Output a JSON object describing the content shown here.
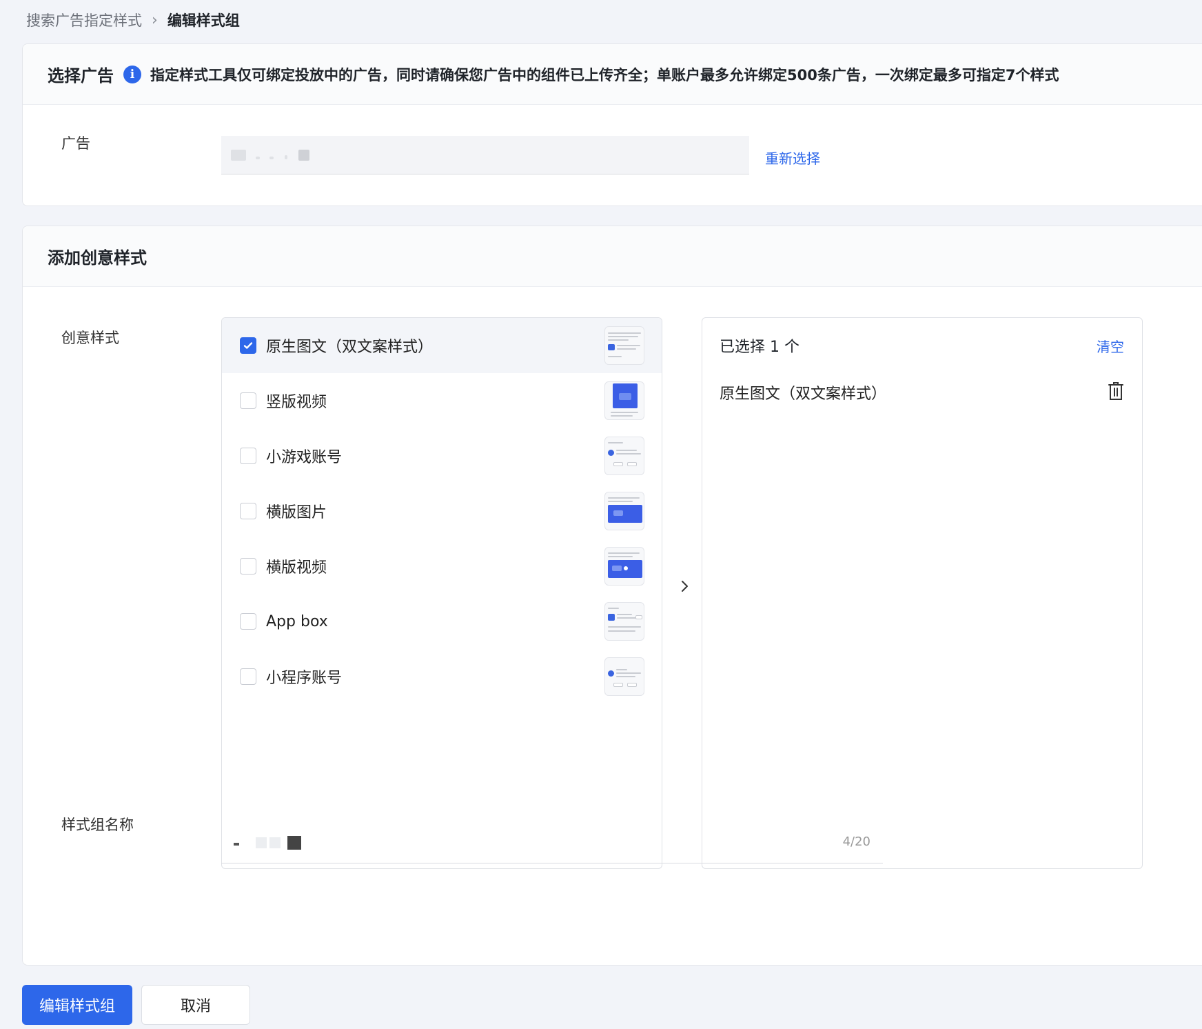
{
  "breadcrumb": {
    "parent": "搜索广告指定样式",
    "current": "编辑样式组"
  },
  "select_ad": {
    "title": "选择广告",
    "notice": "指定样式工具仅可绑定投放中的广告，同时请确保您广告中的组件已上传齐全；单账户最多允许绑定500条广告，一次绑定最多可指定7个样式",
    "ad_label": "广告",
    "reselect_label": "重新选择"
  },
  "creative": {
    "title": "添加创意样式",
    "style_label": "创意样式",
    "options": [
      {
        "label": "原生图文（双文案样式）",
        "checked": true,
        "thumb": "native-text-image"
      },
      {
        "label": "竖版视频",
        "checked": false,
        "thumb": "vertical-video"
      },
      {
        "label": "小游戏账号",
        "checked": false,
        "thumb": "mini-game-account"
      },
      {
        "label": "横版图片",
        "checked": false,
        "thumb": "horizontal-image"
      },
      {
        "label": "横版视频",
        "checked": false,
        "thumb": "horizontal-video"
      },
      {
        "label": "App box",
        "checked": false,
        "thumb": "app-box"
      },
      {
        "label": "小程序账号",
        "checked": false,
        "thumb": "mini-program-account"
      }
    ],
    "selected_header": "已选择 1 个",
    "clear_label": "清空",
    "selected_items": [
      "原生图文（双文案样式）"
    ],
    "group_name_label": "样式组名称",
    "group_name_counter": "4/20"
  },
  "actions": {
    "submit_label": "编辑样式组",
    "cancel_label": "取消"
  },
  "colors": {
    "accent": "#2d67ea",
    "background": "#f2f4f9"
  }
}
